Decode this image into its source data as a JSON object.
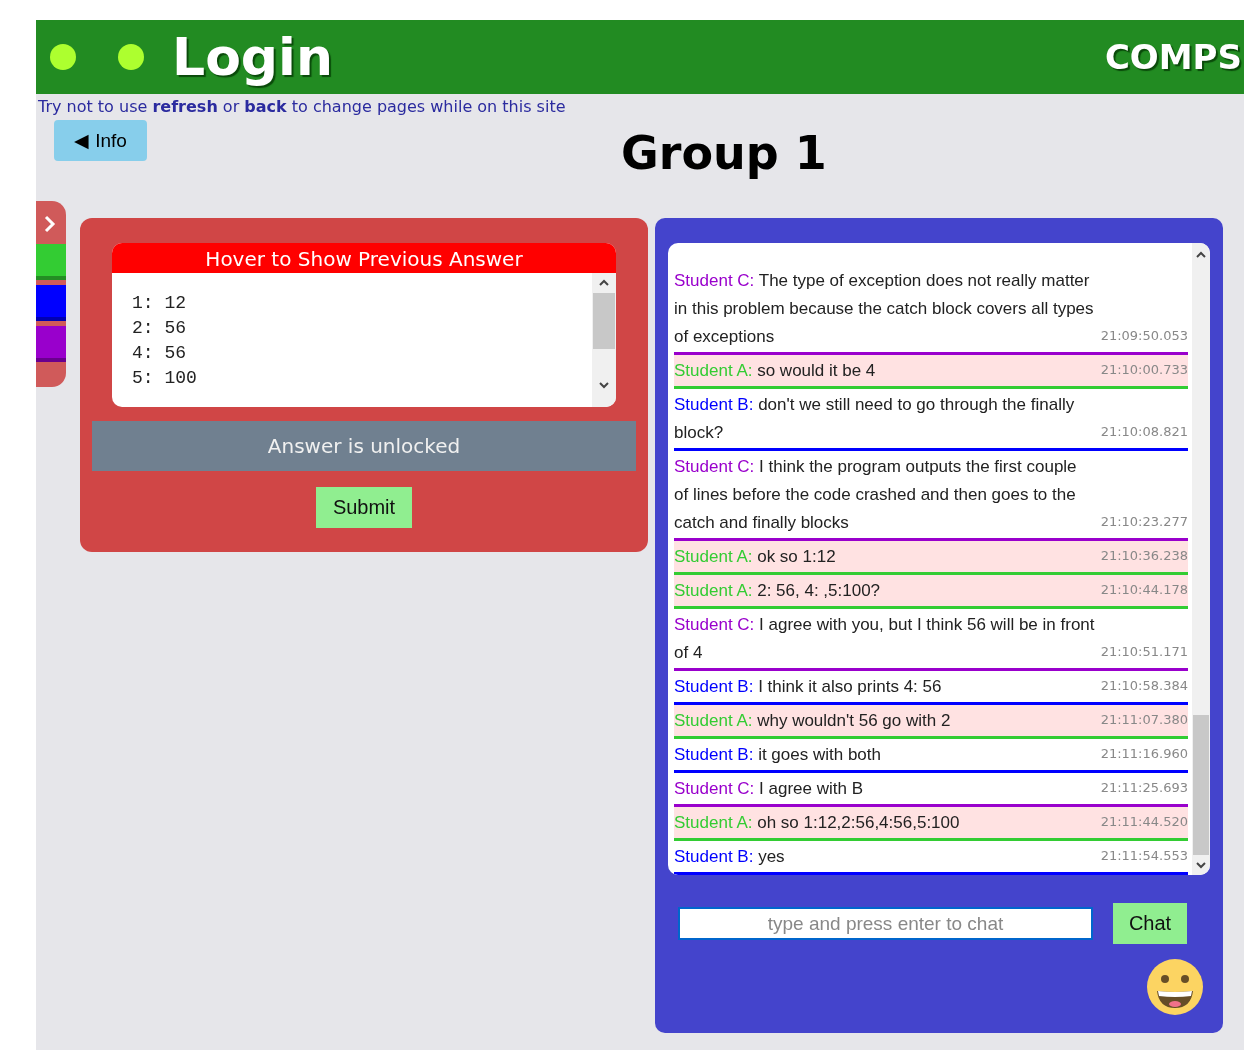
{
  "header": {
    "title": "Login",
    "brand": "COMPS"
  },
  "notice": "Try not to use **refresh** or **back** to change pages while on this site",
  "info_button": {
    "icon": "◀",
    "label": "Info"
  },
  "group_title": "Group 1",
  "side_tabs": [
    {
      "color": "#33cc33"
    },
    {
      "color": "#0000ff"
    },
    {
      "color": "#9900cc"
    }
  ],
  "answer_panel": {
    "title": "Hover to Show Previous Answer",
    "lines": [
      "1: 12",
      "2: 56",
      "4: 56",
      "5: 100"
    ],
    "status": "Answer is unlocked",
    "submit": "Submit"
  },
  "chat": {
    "messages": [
      {
        "sender": "Student C:",
        "text": "The type of exception does not really matter in this problem because the catch block covers all types of exceptions",
        "time": "21:09:50.053",
        "color": "#9900cc",
        "highlighted": false
      },
      {
        "sender": "Student A:",
        "text": "so would it be 4",
        "time": "21:10:00.733",
        "color": "#33cc33",
        "highlighted": true
      },
      {
        "sender": "Student B:",
        "text": "don't we still need to go through the finally block?",
        "time": "21:10:08.821",
        "color": "#0000ff",
        "highlighted": false
      },
      {
        "sender": "Student C:",
        "text": "I think the program outputs the first couple of lines before the code crashed and then goes to the catch and finally blocks",
        "time": "21:10:23.277",
        "color": "#9900cc",
        "highlighted": false
      },
      {
        "sender": "Student A:",
        "text": "ok so 1:12",
        "time": "21:10:36.238",
        "color": "#33cc33",
        "highlighted": true
      },
      {
        "sender": "Student A:",
        "text": "2: 56, 4: ,5:100?",
        "time": "21:10:44.178",
        "color": "#33cc33",
        "highlighted": true
      },
      {
        "sender": "Student C:",
        "text": "I agree with you, but I think 56 will be in front of 4",
        "time": "21:10:51.171",
        "color": "#9900cc",
        "highlighted": false
      },
      {
        "sender": "Student B:",
        "text": "I think it also prints 4: 56",
        "time": "21:10:58.384",
        "color": "#0000ff",
        "highlighted": false
      },
      {
        "sender": "Student A:",
        "text": "why wouldn't 56 go with 2",
        "time": "21:11:07.380",
        "color": "#33cc33",
        "highlighted": true
      },
      {
        "sender": "Student B:",
        "text": "it goes with both",
        "time": "21:11:16.960",
        "color": "#0000ff",
        "highlighted": false
      },
      {
        "sender": "Student C:",
        "text": "I agree with B",
        "time": "21:11:25.693",
        "color": "#9900cc",
        "highlighted": false
      },
      {
        "sender": "Student A:",
        "text": "oh so 1:12,2:56,4:56,5:100",
        "time": "21:11:44.520",
        "color": "#33cc33",
        "highlighted": true
      },
      {
        "sender": "Student B:",
        "text": "yes",
        "time": "21:11:54.553",
        "color": "#0000ff",
        "highlighted": false
      }
    ],
    "input_placeholder": "type and press enter to chat",
    "send": "Chat"
  }
}
